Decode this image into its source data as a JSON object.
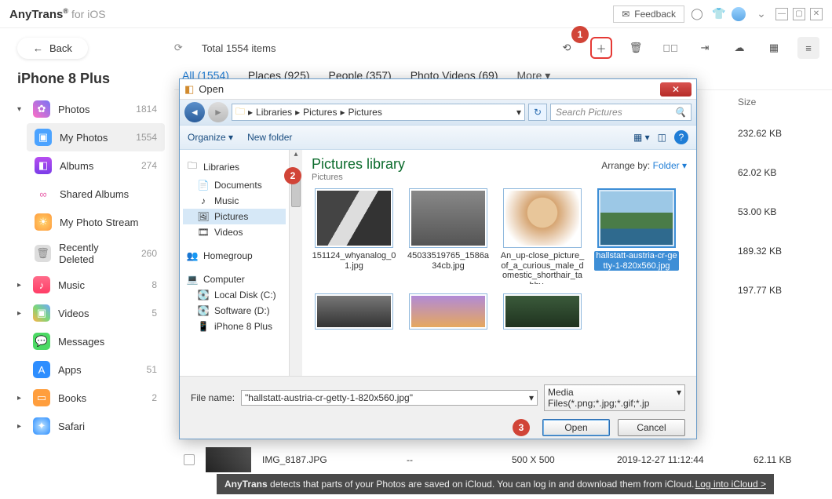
{
  "titlebar": {
    "app_name": "AnyTrans",
    "app_reg": "®",
    "for_ios": "for iOS",
    "feedback": "Feedback"
  },
  "toolbar": {
    "back": "Back",
    "total": "Total 1554 items"
  },
  "callouts": {
    "c1": "1",
    "c2": "2",
    "c3": "3"
  },
  "device": "iPhone 8 Plus",
  "sidebar": {
    "photos": {
      "label": "Photos",
      "count": "1814"
    },
    "my_photos": {
      "label": "My Photos",
      "count": "1554"
    },
    "albums": {
      "label": "Albums",
      "count": "274"
    },
    "shared_albums": {
      "label": "Shared Albums"
    },
    "photo_stream": {
      "label": "My Photo Stream"
    },
    "recently_deleted": {
      "label": "Recently Deleted",
      "count": "260"
    },
    "music": {
      "label": "Music",
      "count": "8"
    },
    "videos": {
      "label": "Videos",
      "count": "5"
    },
    "messages": {
      "label": "Messages"
    },
    "apps": {
      "label": "Apps",
      "count": "51"
    },
    "books": {
      "label": "Books",
      "count": "2"
    },
    "safari": {
      "label": "Safari"
    }
  },
  "tabs": {
    "all": "All (1554)",
    "places": "Places (925)",
    "people": "People (357)",
    "photo_videos": "Photo Videos (69)",
    "more": "More"
  },
  "headers": {
    "size": "Size"
  },
  "rows": {
    "r1": "232.62 KB",
    "r2": "62.02 KB",
    "r3": "53.00 KB",
    "r4": "189.32 KB",
    "r5": "197.77 KB"
  },
  "lastrow": {
    "name": "IMG_8187.JPG",
    "dash": "--",
    "res": "500 X 500",
    "date": "2019-12-27 11:12:44",
    "size": "62.11 KB"
  },
  "dialog": {
    "title": "Open",
    "path": {
      "p1": "Libraries",
      "p2": "Pictures",
      "p3": "Pictures"
    },
    "search_placeholder": "Search Pictures",
    "organize": "Organize",
    "new_folder": "New folder",
    "tree": {
      "libraries": "Libraries",
      "documents": "Documents",
      "music": "Music",
      "pictures": "Pictures",
      "videos": "Videos",
      "homegroup": "Homegroup",
      "computer": "Computer",
      "local": "Local Disk (C:)",
      "software": "Software (D:)",
      "iphone": "iPhone 8 Plus"
    },
    "lib_title": "Pictures library",
    "lib_sub": "Pictures",
    "arrange_label": "Arrange by:",
    "arrange_value": "Folder",
    "files": {
      "f1": "151124_whyanalog_01.jpg",
      "f2": "45033519765_1586a34cb.jpg",
      "f3": "An_up-close_picture_of_a_curious_male_domestic_shorthair_tabby_...",
      "f4": "hallstatt-austria-cr-getty-1-820x560.jpg"
    },
    "filename_label": "File name:",
    "filename_value": "\"hallstatt-austria-cr-getty-1-820x560.jpg\"",
    "filter": "Media Files(*.png;*.jpg;*.gif;*.jp",
    "open": "Open",
    "cancel": "Cancel"
  },
  "notice": {
    "prefix": "AnyTrans",
    "text": " detects that parts of your Photos are saved on iCloud. You can log in and download them from iCloud. ",
    "link": "Log into iCloud >"
  }
}
